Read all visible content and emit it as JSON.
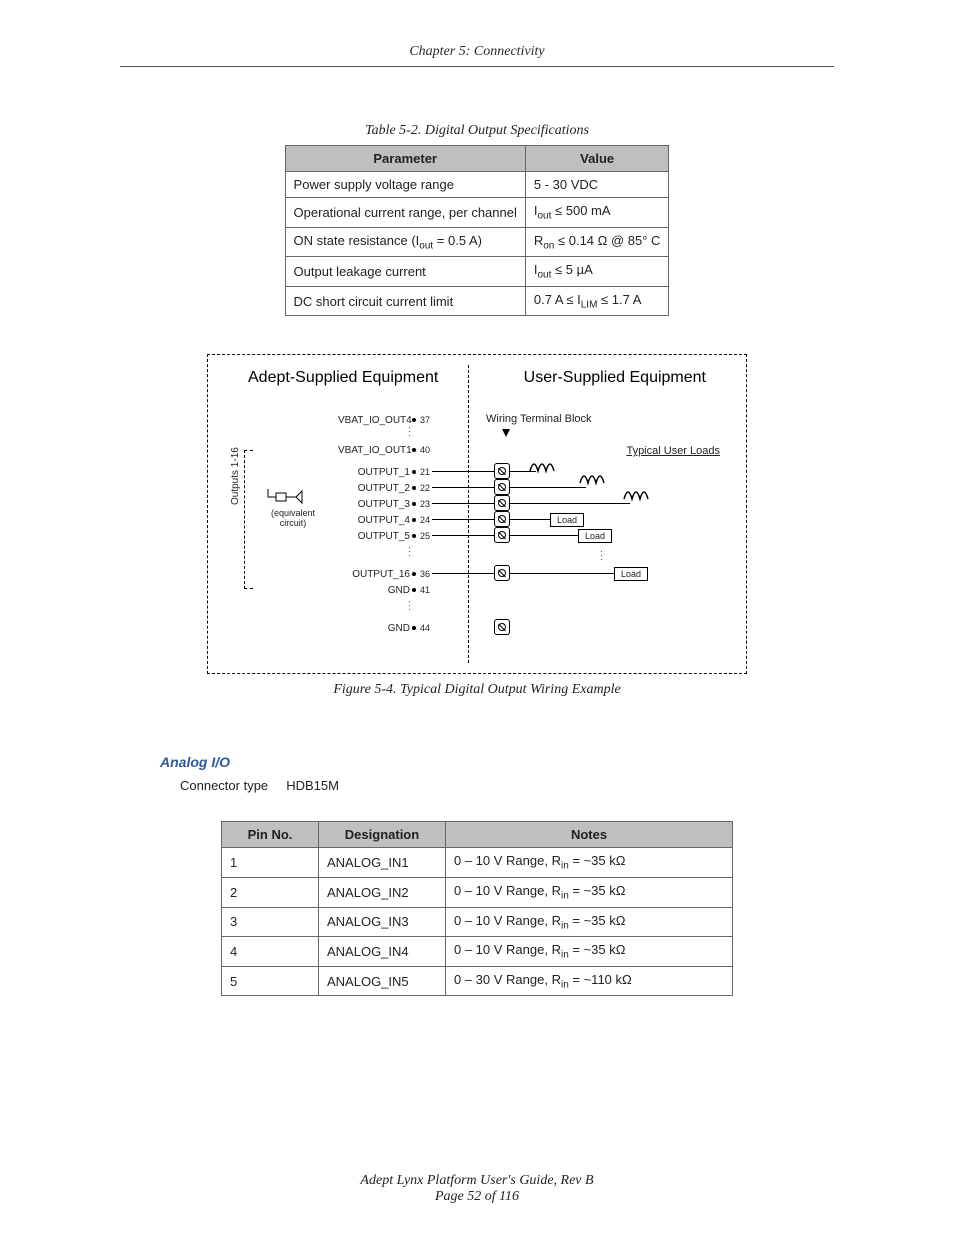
{
  "header": "Chapter 5: Connectivity",
  "table1": {
    "caption": "Table 5-2. Digital Output Specifications",
    "head": {
      "c1": "Parameter",
      "c2": "Value"
    },
    "r1": {
      "c1": "Power supply voltage range",
      "c2": "5 - 30 VDC"
    },
    "r2": {
      "c1": "Operational current range, per channel",
      "c2_pre": "I",
      "c2_sub": "out",
      "c2_post": " ≤ 500 mA"
    },
    "r3": {
      "c1_pre": "ON state resistance (I",
      "c1_sub": "out",
      "c1_post": " = 0.5 A)",
      "c2_pre": "R",
      "c2_sub": "on",
      "c2_post": " ≤ 0.14 Ω @ 85° C"
    },
    "r4": {
      "c1": "Output leakage current",
      "c2_pre": "I",
      "c2_sub": "out",
      "c2_post": " ≤ 5 µA"
    },
    "r5": {
      "c1": "DC short circuit current limit",
      "c2_pre": "0.7 A ≤ I",
      "c2_sub": "LIM",
      "c2_post": " ≤ 1.7 A"
    }
  },
  "figure": {
    "caption": "Figure 5-4. Typical Digital Output Wiring Example",
    "left_title": "Adept-Supplied Equipment",
    "right_title": "User-Supplied Equipment",
    "wtb": "Wiring Terminal Block",
    "tul": "Typical User Loads",
    "side": "Outputs 1-16",
    "eqc": "(equivalent\ncircuit)",
    "load": "Load",
    "vbat4": "VBAT_IO_OUT4",
    "p37": "37",
    "vbat1": "VBAT_IO_OUT1",
    "p40": "40",
    "o1": "OUTPUT_1",
    "p21": "21",
    "o2": "OUTPUT_2",
    "p22": "22",
    "o3": "OUTPUT_3",
    "p23": "23",
    "o4": "OUTPUT_4",
    "p24": "24",
    "o5": "OUTPUT_5",
    "p25": "25",
    "o16": "OUTPUT_16",
    "p36": "36",
    "gnd": "GND",
    "p41": "41",
    "p44": "44"
  },
  "analog": {
    "heading": "Analog I/O",
    "conn_label": "Connector type",
    "conn_value": "HDB15M"
  },
  "table2": {
    "head": {
      "c1": "Pin No.",
      "c2": "Designation",
      "c3": "Notes"
    },
    "rows": [
      {
        "pin": "1",
        "des": "ANALOG_IN1",
        "n_pre": "0 – 10 V Range, R",
        "n_sub": "in",
        "n_post": " = ~35 kΩ"
      },
      {
        "pin": "2",
        "des": "ANALOG_IN2",
        "n_pre": "0 – 10 V Range, R",
        "n_sub": "in",
        "n_post": " = ~35 kΩ"
      },
      {
        "pin": "3",
        "des": "ANALOG_IN3",
        "n_pre": "0 – 10 V Range, R",
        "n_sub": "in",
        "n_post": " = ~35 kΩ"
      },
      {
        "pin": "4",
        "des": "ANALOG_IN4",
        "n_pre": "0 – 10 V Range, R",
        "n_sub": "in",
        "n_post": " = ~35 kΩ"
      },
      {
        "pin": "5",
        "des": "ANALOG_IN5",
        "n_pre": "0 – 30 V Range, R",
        "n_sub": "in",
        "n_post": " = ~110 kΩ"
      }
    ]
  },
  "footer": {
    "l1": "Adept Lynx Platform User's Guide, Rev B",
    "l2": "Page 52 of 116"
  }
}
